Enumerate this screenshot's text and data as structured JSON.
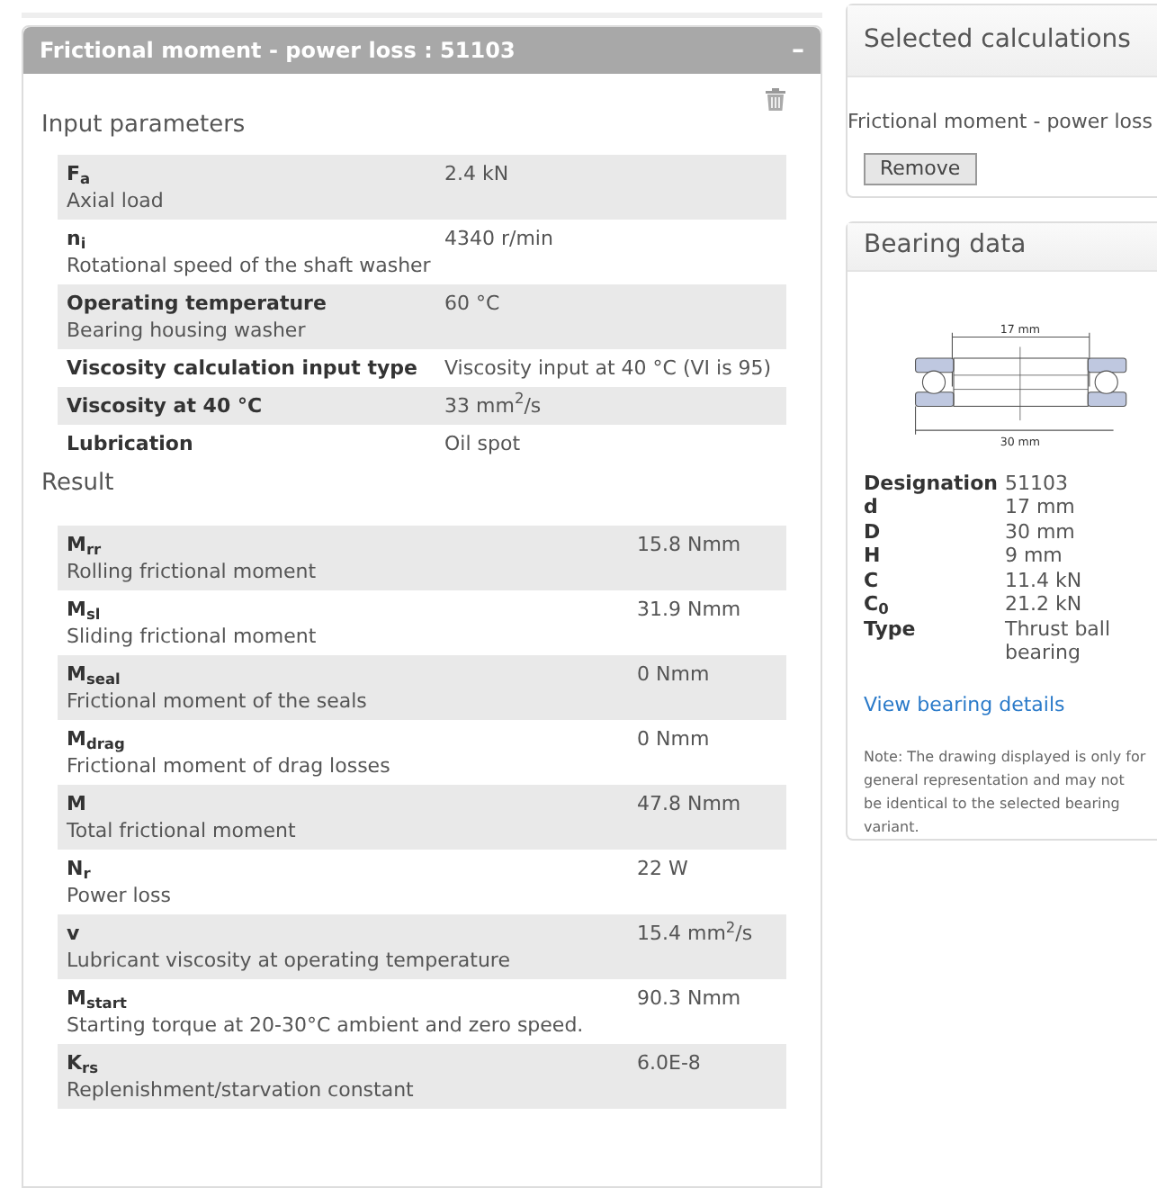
{
  "calculation_panel": {
    "title": "Frictional moment - power loss : 51103",
    "collapse_symbol": "–",
    "input_heading": "Input parameters",
    "inputs": [
      {
        "name": "F$_{a}$",
        "description": "Axial load",
        "value": "2.4 kN"
      },
      {
        "name": "n$_{i}$",
        "description": "Rotational speed of the shaft washer",
        "value": "4340 r/min"
      },
      {
        "name": "Operating temperature",
        "description": "Bearing housing washer",
        "value": "60 °C"
      },
      {
        "name": "Viscosity calculation input type",
        "value": "Viscosity input at 40 °C (VI is 95)"
      },
      {
        "name": "Viscosity at 40 °C",
        "value": "33 mm$^{2}$/s"
      },
      {
        "name": "Lubrication",
        "value": "Oil spot"
      }
    ],
    "result_heading": "Result",
    "results": [
      {
        "name": "M$_{rr}$",
        "description": "Rolling frictional moment",
        "value": "15.8 Nmm"
      },
      {
        "name": "M$_{sl}$",
        "description": "Sliding frictional moment",
        "value": "31.9 Nmm"
      },
      {
        "name": "M$_{seal}$",
        "description": "Frictional moment of the seals",
        "value": "0 Nmm"
      },
      {
        "name": "M$_{drag}$",
        "description": "Frictional moment of drag losses",
        "value": "0 Nmm"
      },
      {
        "name": "M",
        "description": "Total frictional moment",
        "value": "47.8 Nmm"
      },
      {
        "name": "N$_{r}$",
        "description": "Power loss",
        "value": "22 W"
      },
      {
        "name": "v",
        "description": "Lubricant viscosity at operating temperature",
        "value": "15.4 mm$^{2}$/s"
      },
      {
        "name": "M$_{start}$",
        "description": "Starting torque at 20-30°C ambient and zero speed.",
        "value": "90.3 Nmm"
      },
      {
        "name": "K$_{rs}$",
        "description": "Replenishment/starvation constant",
        "value": "6.0E-8"
      }
    ]
  },
  "selected_calculations": {
    "title": "Selected calculations",
    "item": "Frictional moment - power loss",
    "button": "Remove"
  },
  "bearing_data": {
    "title": "Bearing data",
    "drawing_labels": {
      "inner": "17 mm",
      "outer": "30 mm"
    },
    "properties": [
      {
        "name": "Designation",
        "value": "51103"
      },
      {
        "name": "d",
        "value": "17 mm"
      },
      {
        "name": "D",
        "value": "30 mm"
      },
      {
        "name": "H",
        "value": "9 mm"
      },
      {
        "name": "C",
        "value": "11.4 kN"
      },
      {
        "name": "C$_{0}$",
        "value": "21.2 kN"
      },
      {
        "name": "Type",
        "value": "Thrust ball bearing"
      }
    ],
    "link": "View bearing details",
    "note": "Note: The drawing displayed is only for general representation and may not be identical to the selected bearing variant."
  }
}
